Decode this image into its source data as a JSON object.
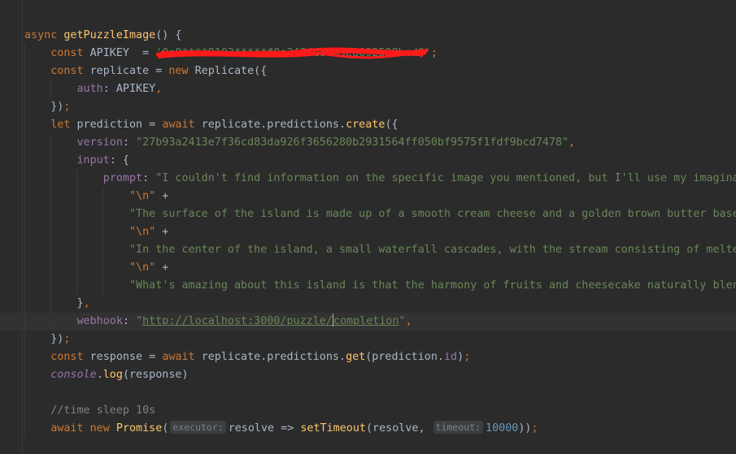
{
  "code": {
    "l1": {
      "kw": "async",
      "fn": "getPuzzleImage",
      "rest": "() {"
    },
    "l2": {
      "kw": "const",
      "text": "APIKEY  = ",
      "str": "'0e0****8103*****f0e3f84e8005e8092528bcd0'",
      "end": ";"
    },
    "l3": {
      "kw1": "const",
      "text1": "replicate = ",
      "kw2": "new",
      "text2": "Replicate({"
    },
    "l4": {
      "prop": "auth",
      "text": ": APIKEY",
      "end": ","
    },
    "l5": {
      "text": "})",
      "end": ";"
    },
    "l6": {
      "kw1": "let",
      "text1": "prediction = ",
      "kw2": "await",
      "text2": "replicate.predictions.",
      "fn": "create",
      "text3": "({"
    },
    "l7": {
      "prop": "version",
      "text": ": ",
      "str": "\"27b93a2413e7f36cd83da926f3656280b2931564ff050bf9575f1fdf9bcd7478\"",
      "end": ","
    },
    "l8": {
      "prop": "input",
      "text": ": {"
    },
    "l9": {
      "prop": "prompt",
      "text": ": ",
      "str": "\"I couldn't find information on the specific image you mentioned, but I'll use my imaginat"
    },
    "l10": {
      "str": "\"\\n\"",
      "text": " +"
    },
    "l11": {
      "str": "\"The surface of the island is made up of a smooth cream cheese and a golden brown butter base,"
    },
    "l12": {
      "str": "\"\\n\"",
      "text": " +"
    },
    "l13": {
      "str": "\"In the center of the island, a small waterfall cascades, with the stream consisting of meltec"
    },
    "l14": {
      "str": "\"\\n\"",
      "text": " +"
    },
    "l15": {
      "str": "\"What's amazing about this island is that the harmony of fruits and cheesecake naturally blenc"
    },
    "l16": {
      "text": "}",
      "end": ","
    },
    "l17": {
      "prop": "webhook",
      "text": ": ",
      "q1": "\"",
      "url1": "http://localhost:3000/puzzle/",
      "url2": "completion",
      "q2": "\"",
      "end": ","
    },
    "l18": {
      "text": "})",
      "end": ";"
    },
    "l19": {
      "kw1": "const",
      "text1": "response = ",
      "kw2": "await",
      "text2": "replicate.predictions.",
      "fn": "get",
      "text3": "(prediction.",
      "prop": "id",
      "text4": ")",
      "end": ";"
    },
    "l20": {
      "ifn": "console",
      "text1": ".",
      "fn": "log",
      "text2": "(response)"
    },
    "l21": {
      "cmt": "//time sleep 10s"
    },
    "l22": {
      "kw1": "await",
      "kw2": "new",
      "fn": "Promise",
      "text1": "(",
      "hint1": "executor:",
      "text2": "resolve => ",
      "fn2": "setTimeout",
      "text3": "(resolve, ",
      "hint2": "timeout:",
      "num": "10000",
      "text4": "))",
      "end": ";"
    }
  },
  "colors": {
    "bg": "#2b2b2b",
    "keyword": "#cc7832",
    "function": "#ffc66d",
    "string": "#6a8759",
    "property": "#9876aa",
    "number": "#6897bb",
    "comment": "#808080",
    "redaction": "#ff1a1a"
  }
}
